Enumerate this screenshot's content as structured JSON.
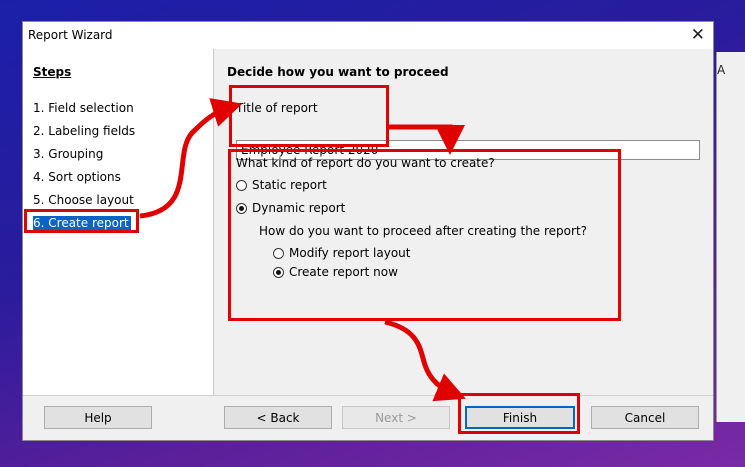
{
  "window": {
    "title": "Report Wizard",
    "close_glyph": "✕"
  },
  "background": {
    "partial_letter": "A"
  },
  "steps": {
    "heading": "Steps",
    "items": [
      {
        "label": "1. Field selection"
      },
      {
        "label": "2. Labeling fields"
      },
      {
        "label": "3. Grouping"
      },
      {
        "label": "4. Sort options"
      },
      {
        "label": "5. Choose layout"
      },
      {
        "label": "6. Create report",
        "selected": true
      }
    ]
  },
  "main": {
    "heading": "Decide how you want to proceed",
    "title_label": "Title of report",
    "title_value": "Employee Report 2020",
    "kind_question": "What kind of report do you want to create?",
    "kind_options": [
      {
        "label": "Static report",
        "checked": false
      },
      {
        "label": "Dynamic report",
        "checked": true
      }
    ],
    "proceed_question": "How do you want to proceed after creating the report?",
    "proceed_options": [
      {
        "label": "Modify report layout",
        "checked": false
      },
      {
        "label": "Create report now",
        "checked": true
      }
    ]
  },
  "buttons": {
    "help": "Help",
    "back": "< Back",
    "next": "Next >",
    "finish": "Finish",
    "cancel": "Cancel"
  },
  "annotation_color": "#e00000"
}
